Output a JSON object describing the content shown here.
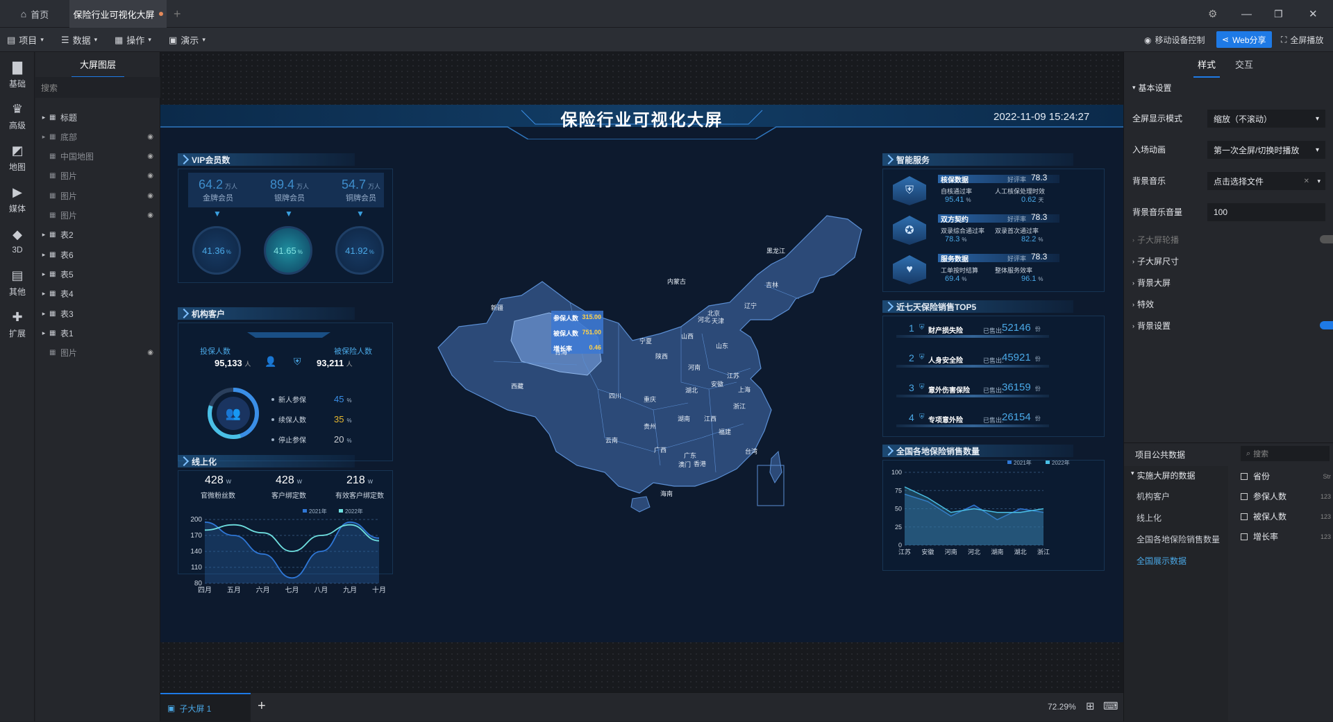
{
  "titlebar": {
    "home_tab": "首页",
    "active_tab": "保险行业可视化大屏",
    "add_tab": "+"
  },
  "menubar": {
    "items": [
      "项目",
      "数据",
      "操作",
      "演示"
    ],
    "mobile": "移动设备控制",
    "web_share": "Web分享",
    "fullscreen": "全屏播放"
  },
  "leftbar": {
    "items": [
      "基础",
      "高级",
      "地图",
      "媒体",
      "3D",
      "其他",
      "扩展"
    ]
  },
  "layers": {
    "title": "大屏图层",
    "search_placeholder": "搜索",
    "items": [
      {
        "label": "标题",
        "arrow": true,
        "dim": false
      },
      {
        "label": "底部",
        "arrow": true,
        "dim": true
      },
      {
        "label": "中国地图",
        "arrow": false,
        "dim": true
      },
      {
        "label": "图片",
        "arrow": false,
        "dim": true
      },
      {
        "label": "图片",
        "arrow": false,
        "dim": true
      },
      {
        "label": "图片",
        "arrow": false,
        "dim": true
      },
      {
        "label": "表2",
        "arrow": true,
        "dim": false
      },
      {
        "label": "表6",
        "arrow": true,
        "dim": false
      },
      {
        "label": "表5",
        "arrow": true,
        "dim": false
      },
      {
        "label": "表4",
        "arrow": true,
        "dim": false
      },
      {
        "label": "表3",
        "arrow": true,
        "dim": false
      },
      {
        "label": "表1",
        "arrow": true,
        "dim": false
      },
      {
        "label": "图片",
        "arrow": false,
        "dim": true
      }
    ]
  },
  "screen": {
    "title": "保险行业可视化大屏",
    "datetime": "2022-11-09 15:24:27",
    "vip": {
      "title": "VIP会员数",
      "unit": "万人",
      "items": [
        {
          "value": "64.2",
          "label": "金牌会员",
          "pct": "41.36"
        },
        {
          "value": "89.4",
          "label": "银牌会员",
          "pct": "41.65"
        },
        {
          "value": "54.7",
          "label": "铜牌会员",
          "pct": "41.92"
        }
      ],
      "pct_unit": "%"
    },
    "org": {
      "title": "机构客户",
      "insured_label": "投保人数",
      "insured_value": "95,133",
      "insure_label": "被保险人数",
      "insure_value": "93,211",
      "person_unit": "人",
      "legend": [
        {
          "label": "新人参保",
          "value": "45",
          "unit": "%",
          "color": "#3a8ee6"
        },
        {
          "label": "续保人数",
          "value": "35",
          "unit": "%",
          "color": "#e6b830"
        },
        {
          "label": "停止参保",
          "value": "20",
          "unit": "%",
          "color": "#c9ccd2"
        }
      ]
    },
    "online": {
      "title": "线上化",
      "stats": [
        {
          "value": "428",
          "unit": "w",
          "label": "官微粉丝数"
        },
        {
          "value": "428",
          "unit": "w",
          "label": "客户绑定数"
        },
        {
          "value": "218",
          "unit": "w",
          "label": "有效客户绑定数"
        }
      ]
    },
    "map": {
      "tooltip": [
        {
          "label": "参保人数",
          "value": "315.00"
        },
        {
          "label": "被保人数",
          "value": "751.00"
        },
        {
          "label": "增长率",
          "value": "0.46"
        }
      ],
      "labels": [
        "新疆",
        "西藏",
        "青海",
        "内蒙古",
        "黑龙江",
        "吉林",
        "辽宁",
        "北京",
        "天津",
        "河北",
        "山西",
        "宁夏",
        "陕西",
        "山东",
        "河南",
        "江苏",
        "上海",
        "安徽",
        "湖北",
        "四川",
        "重庆",
        "浙江",
        "江西",
        "湖南",
        "贵州",
        "福建",
        "云南",
        "广西",
        "广东",
        "香港",
        "澳门",
        "台湾",
        "海南"
      ]
    },
    "service": {
      "title": "智能服务",
      "score_label": "好评率",
      "items": [
        {
          "name": "核保数据",
          "score": "78.3",
          "a_label": "自核通过率",
          "a_value": "95.41",
          "a_unit": "%",
          "b_label": "人工核保处理时效",
          "b_value": "0.62",
          "b_unit": "天"
        },
        {
          "name": "双方契约",
          "score": "78.3",
          "a_label": "双录综合通过率",
          "a_value": "78.3",
          "a_unit": "%",
          "b_label": "双录首次通过率",
          "b_value": "82.2",
          "b_unit": "%"
        },
        {
          "name": "服务数据",
          "score": "78.3",
          "a_label": "工单按时结算",
          "a_value": "69.4",
          "a_unit": "%",
          "b_label": "整体服务效率",
          "b_value": "96.1",
          "b_unit": "%"
        }
      ]
    },
    "top5": {
      "title": "近七天保险销售TOP5",
      "sold_label": "已售出:",
      "unit": "份",
      "items": [
        {
          "rank": "1",
          "name": "财产损失险",
          "value": "52146"
        },
        {
          "rank": "2",
          "name": "人身安全险",
          "value": "45921"
        },
        {
          "rank": "3",
          "name": "意外伤害保险",
          "value": "36159"
        },
        {
          "rank": "4",
          "name": "专项意外险",
          "value": "26154"
        }
      ]
    },
    "sales": {
      "title": "全国各地保险销售数量"
    }
  },
  "chart_data": [
    {
      "type": "line",
      "title": "",
      "categories": [
        "四月",
        "五月",
        "六月",
        "七月",
        "八月",
        "九月",
        "十月"
      ],
      "series": [
        {
          "name": "2021年",
          "values": [
            195,
            170,
            135,
            90,
            140,
            195,
            165
          ]
        },
        {
          "name": "2022年",
          "values": [
            180,
            190,
            175,
            140,
            170,
            190,
            160
          ]
        }
      ],
      "ylim": [
        80,
        200
      ],
      "yticks": [
        "200",
        "170",
        "140",
        "110",
        "80"
      ],
      "legend": "top-right"
    },
    {
      "type": "area",
      "title": "",
      "categories": [
        "江苏",
        "安徽",
        "河南",
        "河北",
        "湖南",
        "湖北",
        "浙江"
      ],
      "series": [
        {
          "name": "2021年",
          "values": [
            70,
            60,
            40,
            55,
            35,
            50,
            45
          ]
        },
        {
          "name": "2022年",
          "values": [
            80,
            65,
            45,
            50,
            45,
            45,
            50
          ]
        }
      ],
      "ylim": [
        0,
        100
      ],
      "yticks": [
        "100",
        "75",
        "50",
        "25",
        "0"
      ],
      "legend": "top-right"
    }
  ],
  "rightpanel": {
    "tabs": [
      "样式",
      "交互"
    ],
    "section": "基本设置",
    "rows": [
      {
        "label": "全屏显示模式",
        "value": "缩放（不滚动）"
      },
      {
        "label": "入场动画",
        "value": "第一次全屏/切换时播放"
      },
      {
        "label": "背景音乐",
        "value": "点击选择文件"
      },
      {
        "label": "背景音乐音量",
        "value": "100"
      }
    ],
    "collapsibles": [
      "子大屏轮播",
      "子大屏尺寸",
      "背景大屏",
      "特效",
      "背景设置"
    ],
    "data_title": "项目公共数据",
    "data_search": "搜索",
    "data_group": "实施大屏的数据",
    "data_items": [
      "机构客户",
      "线上化",
      "全国各地保险销售数量",
      "全国展示数据"
    ],
    "fields": [
      {
        "name": "省份",
        "type": "Str"
      },
      {
        "name": "参保人数",
        "type": "123"
      },
      {
        "name": "被保人数",
        "type": "123"
      },
      {
        "name": "增长率",
        "type": "123"
      }
    ]
  },
  "bottombar": {
    "tab": "子大屏 1",
    "add": "+",
    "zoom": "72.29%"
  },
  "colors": {
    "accent": "#1e7ae6",
    "panel_bg": "#0d1a2e",
    "map_fill": "#2c4a78",
    "map_highlight": "#5a7fb8"
  }
}
